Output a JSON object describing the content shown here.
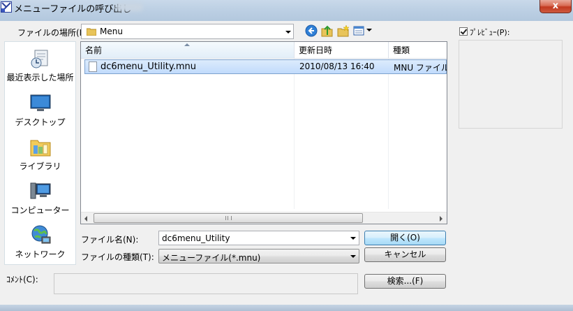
{
  "window": {
    "title": "メニューファイルの呼び出し",
    "close_label": "x"
  },
  "toolbar": {
    "lookin_label": "ファイルの場所(I):",
    "location_value": "Menu",
    "icons": [
      "back-icon",
      "up-folder-icon",
      "new-folder-icon",
      "view-menu-icon"
    ]
  },
  "places": [
    {
      "label": "最近表示した場所",
      "icon": "recent-places-icon"
    },
    {
      "label": "デスクトップ",
      "icon": "desktop-icon"
    },
    {
      "label": "ライブラリ",
      "icon": "libraries-icon"
    },
    {
      "label": "コンピューター",
      "icon": "computer-icon"
    },
    {
      "label": "ネットワーク",
      "icon": "network-icon"
    }
  ],
  "filelist": {
    "columns": [
      "名前",
      "更新日時",
      "種類"
    ],
    "rows": [
      {
        "name": "dc6menu_Utility.mnu",
        "modified": "2010/08/13 16:40",
        "type": "MNU ファイル"
      }
    ],
    "scroll_grip": "III"
  },
  "form": {
    "filename_label": "ファイル名(N):",
    "filename_value": "dc6menu_Utility",
    "filetype_label": "ファイルの種類(T):",
    "filetype_value": "メニューファイル(*.mnu)",
    "comment_label": "ｺﾒﾝﾄ(C):",
    "comment_value": ""
  },
  "buttons": {
    "open": "開く(O)",
    "cancel": "キャンセル",
    "search": "検索...(F)"
  },
  "preview": {
    "label": "ﾌﾟﾚﾋﾞｭｰ(P):",
    "checked": true
  },
  "colors": {
    "selection": "#c1dbfc",
    "selection_border": "#7da2ce",
    "dialog_bg": "#f0f0f0",
    "default_button": "#bee6fd"
  }
}
